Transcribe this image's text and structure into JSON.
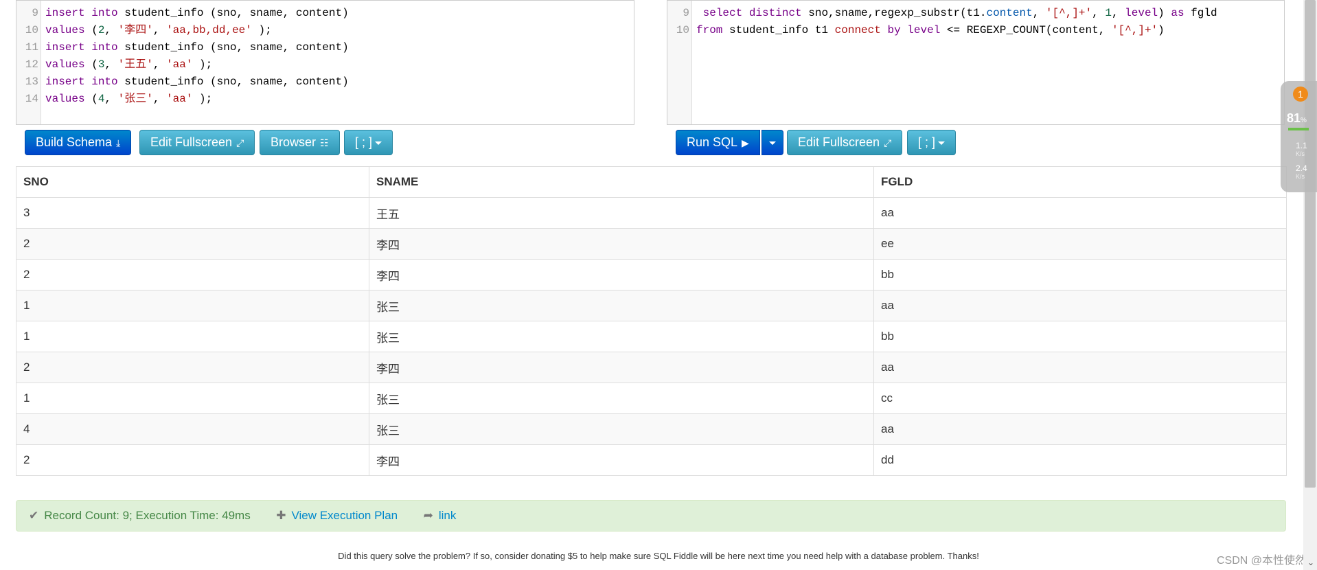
{
  "schema_editor": {
    "lines": [
      {
        "num": "9",
        "tokens": [
          {
            "t": "insert",
            "c": "kw"
          },
          {
            "t": " "
          },
          {
            "t": "into",
            "c": "kw"
          },
          {
            "t": " student_info (sno, sname, content)"
          }
        ]
      },
      {
        "num": "10",
        "tokens": [
          {
            "t": "values",
            "c": "kw"
          },
          {
            "t": " ("
          },
          {
            "t": "2",
            "c": "num"
          },
          {
            "t": ", "
          },
          {
            "t": "'李四'",
            "c": "str"
          },
          {
            "t": ", "
          },
          {
            "t": "'aa,bb,dd,ee'",
            "c": "str"
          },
          {
            "t": " );"
          }
        ]
      },
      {
        "num": "11",
        "tokens": [
          {
            "t": "insert",
            "c": "kw"
          },
          {
            "t": " "
          },
          {
            "t": "into",
            "c": "kw"
          },
          {
            "t": " student_info (sno, sname, content)"
          }
        ]
      },
      {
        "num": "12",
        "tokens": [
          {
            "t": "values",
            "c": "kw"
          },
          {
            "t": " ("
          },
          {
            "t": "3",
            "c": "num"
          },
          {
            "t": ", "
          },
          {
            "t": "'王五'",
            "c": "str"
          },
          {
            "t": ", "
          },
          {
            "t": "'aa'",
            "c": "str"
          },
          {
            "t": " );"
          }
        ]
      },
      {
        "num": "13",
        "tokens": [
          {
            "t": "insert",
            "c": "kw"
          },
          {
            "t": " "
          },
          {
            "t": "into",
            "c": "kw"
          },
          {
            "t": " student_info (sno, sname, content)"
          }
        ]
      },
      {
        "num": "14",
        "tokens": [
          {
            "t": "values",
            "c": "kw"
          },
          {
            "t": " ("
          },
          {
            "t": "4",
            "c": "num"
          },
          {
            "t": ", "
          },
          {
            "t": "'张三'",
            "c": "str"
          },
          {
            "t": ", "
          },
          {
            "t": "'aa'",
            "c": "str"
          },
          {
            "t": " );"
          }
        ]
      }
    ]
  },
  "query_editor": {
    "lines": [
      {
        "num": "9",
        "tokens": [
          {
            "t": " "
          },
          {
            "t": "select",
            "c": "kw"
          },
          {
            "t": " "
          },
          {
            "t": "distinct",
            "c": "kw"
          },
          {
            "t": " sno,sname,regexp_substr(t1."
          },
          {
            "t": "content",
            "c": "var"
          },
          {
            "t": ", "
          },
          {
            "t": "'[^,]+'",
            "c": "str"
          },
          {
            "t": ", "
          },
          {
            "t": "1",
            "c": "num"
          },
          {
            "t": ", "
          },
          {
            "t": "level",
            "c": "kw"
          },
          {
            "t": ") "
          },
          {
            "t": "as",
            "c": "kw"
          },
          {
            "t": " fgld"
          }
        ]
      },
      {
        "num": "10",
        "tokens": [
          {
            "t": "from",
            "c": "kw"
          },
          {
            "t": " student_info t1 "
          },
          {
            "t": "connect",
            "c": "str"
          },
          {
            "t": " "
          },
          {
            "t": "by",
            "c": "kw"
          },
          {
            "t": " "
          },
          {
            "t": "level",
            "c": "kw"
          },
          {
            "t": " <= REGEXP_COUNT(content, "
          },
          {
            "t": "'[^,]+'",
            "c": "str"
          },
          {
            "t": ")"
          }
        ]
      }
    ]
  },
  "toolbar": {
    "build_schema": "Build Schema",
    "edit_fullscreen": "Edit Fullscreen",
    "browser": "Browser",
    "delimiter": "[ ; ]",
    "run_sql": "Run SQL",
    "edit_fullscreen_right": "Edit Fullscreen",
    "delimiter_right": "[ ; ]"
  },
  "results": {
    "columns": [
      "SNO",
      "SNAME",
      "FGLD"
    ],
    "rows": [
      [
        "3",
        "王五",
        "aa"
      ],
      [
        "2",
        "李四",
        "ee"
      ],
      [
        "2",
        "李四",
        "bb"
      ],
      [
        "1",
        "张三",
        "aa"
      ],
      [
        "1",
        "张三",
        "bb"
      ],
      [
        "2",
        "李四",
        "aa"
      ],
      [
        "1",
        "张三",
        "cc"
      ],
      [
        "4",
        "张三",
        "aa"
      ],
      [
        "2",
        "李四",
        "dd"
      ]
    ]
  },
  "status": {
    "record_info": "Record Count: 9; Execution Time: 49ms",
    "view_plan": "View Execution Plan",
    "link": "link"
  },
  "footer": {
    "text": "Did this query solve the problem? If so, consider donating $5 to help make sure SQL Fiddle will be here next time you need help with a database problem. Thanks!",
    "watermark": "CSDN @本性使然"
  },
  "net_widget": {
    "badge": "1",
    "percent": "81",
    "percent_unit": "%",
    "up_value": "1.1",
    "down_value": "2.4",
    "unit": "K/s"
  },
  "colors": {
    "keyword": "#770088",
    "string": "#aa1111",
    "number": "#116644",
    "primary_button": "#0055cc",
    "info_button": "#49afcd",
    "success_bg": "#dff0d8"
  }
}
